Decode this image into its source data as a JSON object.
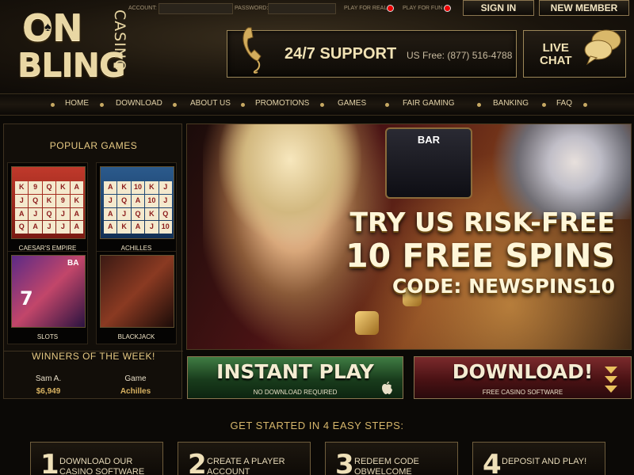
{
  "logo": {
    "on": "ON",
    "bling": "BLING",
    "casino": "CASINO"
  },
  "login": {
    "account_label": "ACCOUNT:",
    "password_label": "PASSWORD:",
    "play_real": "PLAY FOR REAL",
    "play_fun": "PLAY FOR FUN",
    "sign_in": "SIGN IN",
    "new_member": "NEW MEMBER"
  },
  "support": {
    "title": "24/7 SUPPORT",
    "phone": "US Free: (877) 516-4788",
    "icon": "phone-icon"
  },
  "chat": {
    "line1": "LIVE",
    "line2": "CHAT",
    "icon": "speech-bubble-icon"
  },
  "nav": {
    "items": [
      "HOME",
      "DOWNLOAD",
      "ABOUT US",
      "PROMOTIONS",
      "GAMES",
      "FAIR GAMING",
      "BANKING",
      "FAQ"
    ]
  },
  "popular_games": {
    "title": "POPULAR GAMES",
    "games": [
      {
        "label": "CAESAR'S EMPIRE"
      },
      {
        "label": "ACHILLES"
      },
      {
        "label": "SLOTS"
      },
      {
        "label": "BLACKJACK"
      }
    ]
  },
  "winners": {
    "title": "WINNERS OF THE WEEK!",
    "name": "Sam A.",
    "amount": "$6,949",
    "game_header": "Game",
    "game": "Achilles"
  },
  "banner": {
    "slot_label": "BAR",
    "line1": "TRY US RISK-FREE",
    "line2": "10 FREE SPINS",
    "line3": "CODE: NEWSPINS10"
  },
  "cta": {
    "instant_title": "INSTANT PLAY",
    "instant_sub": "NO DOWNLOAD REQUIRED",
    "download_title": "DOWNLOAD!",
    "download_sub": "FREE CASINO SOFTWARE"
  },
  "steps": {
    "title": "GET STARTED IN 4 EASY STEPS:",
    "items": [
      {
        "num": "1",
        "line1": "DOWNLOAD OUR",
        "line2": "CASINO SOFTWARE"
      },
      {
        "num": "2",
        "line1": "CREATE A PLAYER",
        "line2": "ACCOUNT"
      },
      {
        "num": "3",
        "line1": "REDEEM CODE",
        "line2": "OBWELCOME"
      },
      {
        "num": "4",
        "line1": "DEPOSIT AND PLAY!",
        "line2": ""
      }
    ]
  },
  "colors": {
    "gold": "#e6c983",
    "instant_green": "#3f7c43",
    "download_red": "#7b2a2c"
  }
}
